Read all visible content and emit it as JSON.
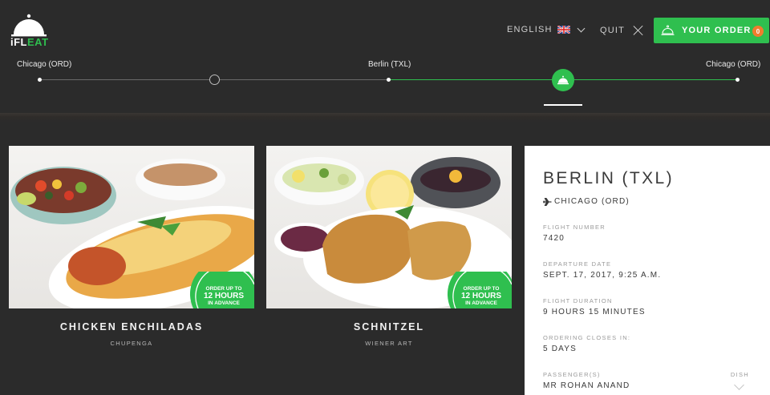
{
  "brand": {
    "logo_text_a": "iFL",
    "logo_text_b": "EAT"
  },
  "nav": {
    "language_label": "ENGLISH",
    "flag_icon": "uk-flag-icon",
    "quit_label": "QUIT",
    "order_label": "YOUR ORDER",
    "order_count": "0"
  },
  "route": {
    "origin": "Chicago (ORD)",
    "stop": "Berlin (TXL)",
    "destination": "Chicago (ORD)"
  },
  "dishes": [
    {
      "name": "CHICKEN ENCHILADAS",
      "restaurant": "CHUPENGA",
      "badge_top": "ORDER UP TO",
      "badge_mid": "12 HOURS",
      "badge_bot": "IN ADVANCE"
    },
    {
      "name": "SCHNITZEL",
      "restaurant": "WIENER ART",
      "badge_top": "ORDER UP TO",
      "badge_mid": "12 HOURS",
      "badge_bot": "IN ADVANCE"
    }
  ],
  "flight": {
    "title": "BERLIN (TXL)",
    "destination": "CHICAGO (ORD)",
    "number_label": "FLIGHT NUMBER",
    "number": "7420",
    "departure_label": "DEPARTURE DATE",
    "departure": "SEPT. 17, 2017, 9:25 A.M.",
    "duration_label": "FLIGHT DURATION",
    "duration": "9 HOURS 15 MINUTES",
    "closes_label": "ORDERING CLOSES IN:",
    "closes": "5 DAYS",
    "passenger_label": "PASSENGER(S)",
    "passenger": "MR ROHAN ANAND",
    "dish_label": "DISH"
  },
  "colors": {
    "accent": "#2fbf4f",
    "badge": "#f07c2e",
    "background": "#2b2b2b"
  }
}
